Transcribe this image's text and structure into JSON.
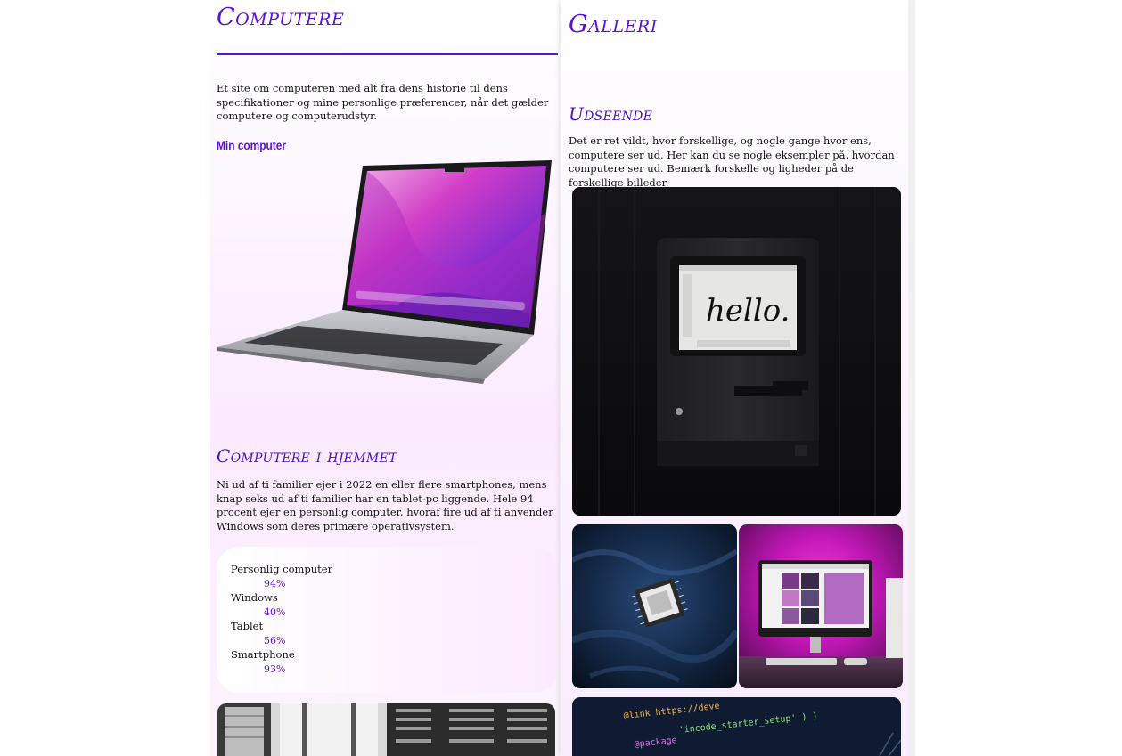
{
  "left": {
    "title": "Computere",
    "intro": "Et site om computeren med alt fra dens historie til dens specifikationer og mine personlige præferencer, når det gælder computere og computerudstyr.",
    "my_computer_heading": "Min computer",
    "home_heading": "Computere i hjemmet",
    "home_text": "Ni ud af ti familier ejer i 2022 en eller flere smartphones, mens knap seks ud af ti familier har en tablet-pc liggende. Hele 94 procent ejer en personlig computer, hvoraf fire ud af ti anvender Windows som deres primære operativsystem.",
    "stats": [
      {
        "label": "Personlig computer",
        "value": "94%"
      },
      {
        "label": "Windows",
        "value": "40%"
      },
      {
        "label": "Tablet",
        "value": "56%"
      },
      {
        "label": "Smartphone",
        "value": "93%"
      }
    ]
  },
  "right": {
    "title": "Galleri",
    "subheading": "Udseende",
    "text": "Det er ret vildt, hvor forskellige, og nogle gange hvor ens, computere ser ud. Her kan du se nogle eksempler på, hvordan computere ser ud. Bemærk forskelle og ligheder på de forskellige billeder.",
    "mac_screen_text": "hello.",
    "code_line_1": "@link https://deve",
    "code_line_2": "'incode_starter_setup' ) )",
    "code_line_3": "@package"
  },
  "colors": {
    "accent": "#5a12d8",
    "heading": "#4a10c4"
  }
}
